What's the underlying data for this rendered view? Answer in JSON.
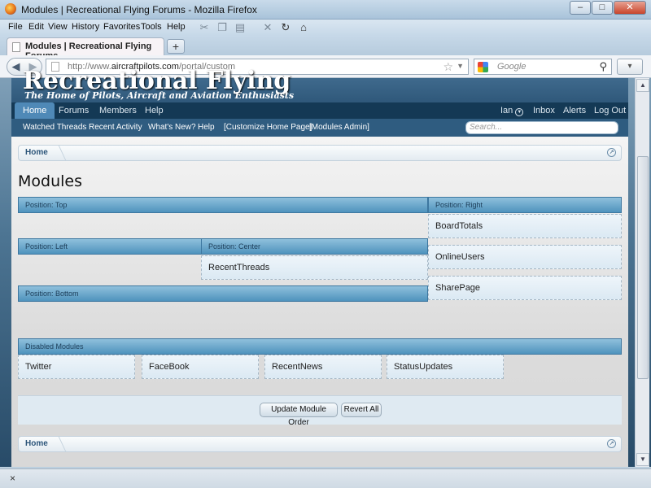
{
  "window": {
    "title": "Modules | Recreational Flying Forums - Mozilla Firefox"
  },
  "menu": [
    "File",
    "Edit",
    "View",
    "History",
    "Favorites",
    "Tools",
    "Help"
  ],
  "tab": {
    "label": "Modules | Recreational Flying Forums"
  },
  "urlbar": {
    "prefix": "http://www.",
    "domain": "aircraftpilots.com",
    "path": "/portal/custom"
  },
  "websearch": {
    "placeholder": "Google"
  },
  "site": {
    "logo": "Recreational Flying",
    "tagline": "The Home of Pilots, Aircraft and Aviation Enthusiasts",
    "nav": [
      "Home",
      "Forums",
      "Members",
      "Help"
    ],
    "account": {
      "user": "Ian",
      "inbox": "Inbox",
      "alerts": "Alerts",
      "logout": "Log Out"
    },
    "subnav": [
      "Watched Threads",
      "Recent Activity",
      "What's New?",
      "Help",
      "[Customize Home Page]",
      "[Modules Admin]"
    ],
    "search_placeholder": "Search..."
  },
  "breadcrumb": {
    "home": "Home"
  },
  "page_title": "Modules",
  "positions": {
    "top": "Position: Top",
    "right": "Position: Right",
    "left": "Position: Left",
    "center": "Position: Center",
    "bottom": "Position: Bottom",
    "disabled": "Disabled Modules"
  },
  "modules": {
    "right": [
      "BoardTotals",
      "OnlineUsers",
      "SharePage"
    ],
    "center": [
      "RecentThreads"
    ],
    "disabled": [
      "Twitter",
      "FaceBook",
      "RecentNews",
      "StatusUpdates"
    ]
  },
  "buttons": {
    "update": "Update Module Order",
    "revert": "Revert All"
  },
  "status": {
    "close": "×"
  }
}
